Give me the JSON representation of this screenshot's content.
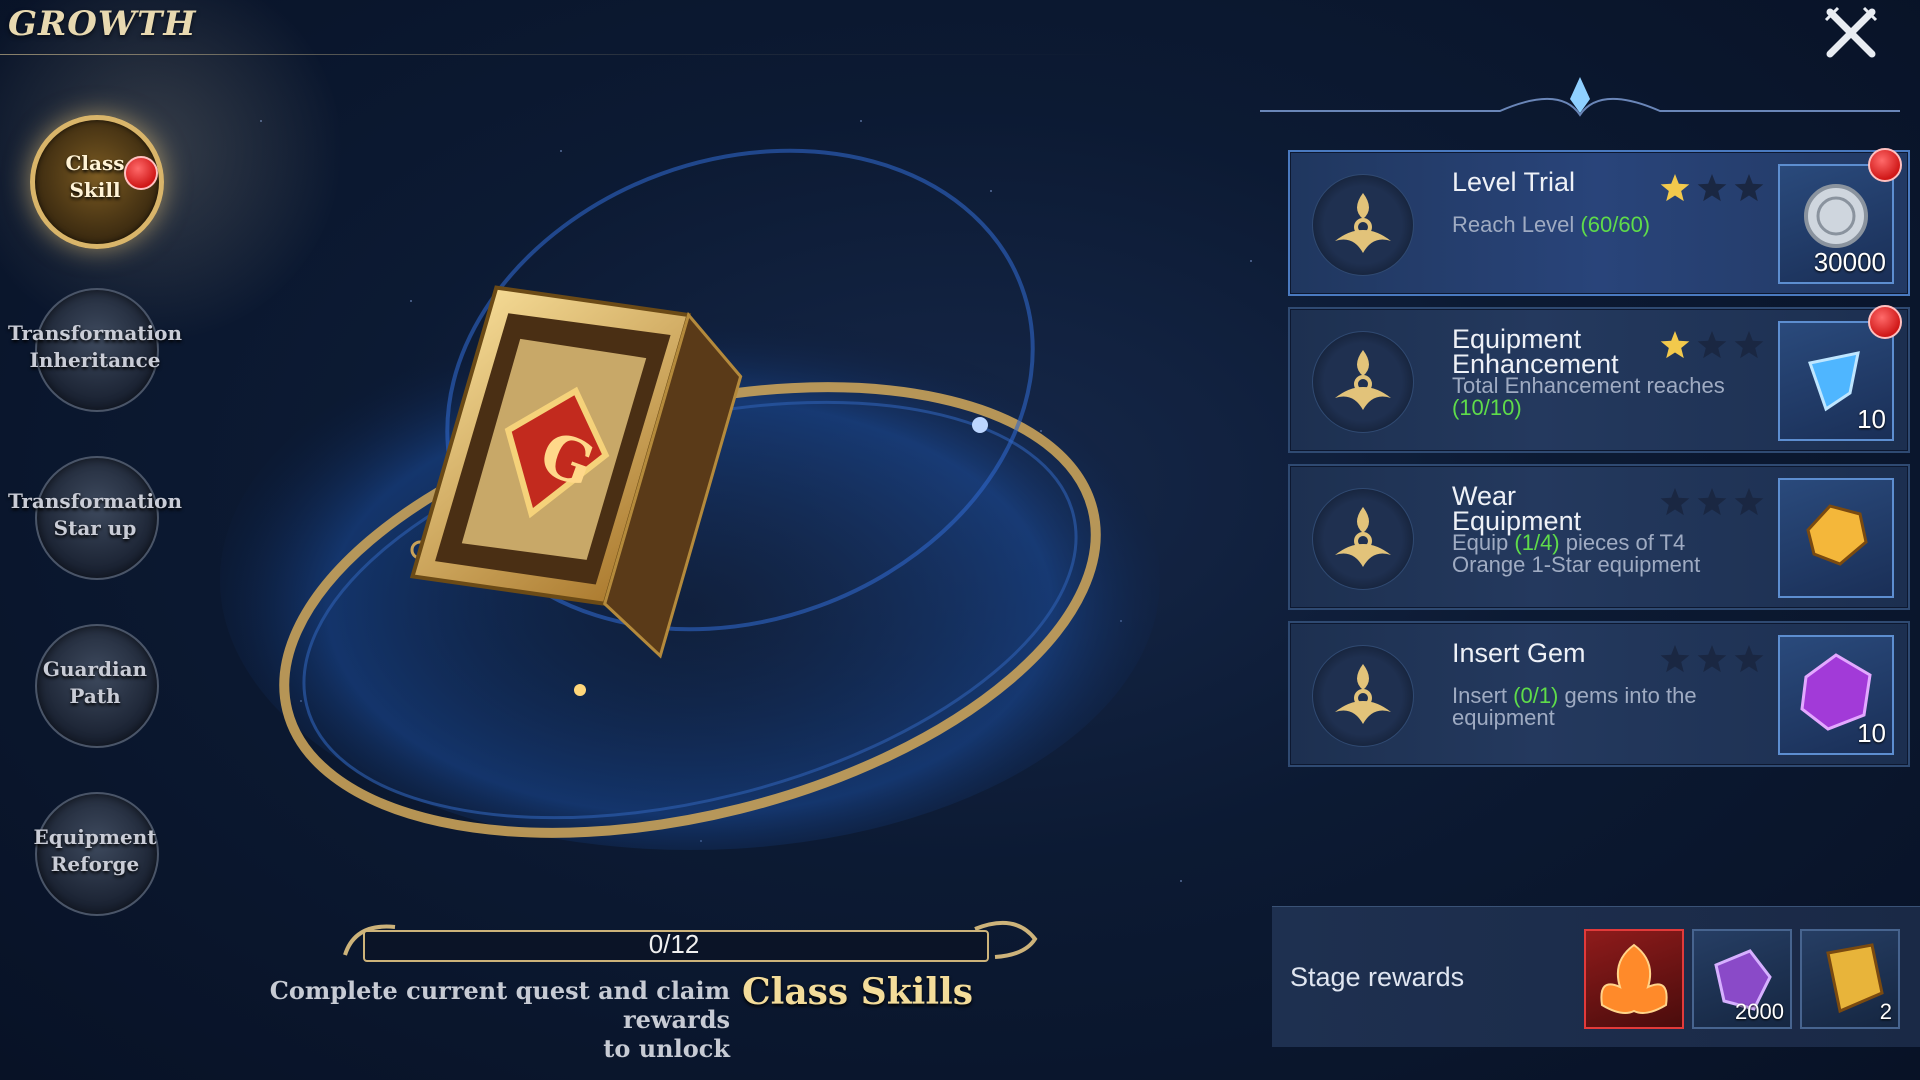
{
  "header": {
    "title": "GROWTH"
  },
  "nav": {
    "items": [
      {
        "label": "Class\nSkill",
        "active": true,
        "badge": true
      },
      {
        "label": "Transformation\nInheritance",
        "active": false,
        "badge": false
      },
      {
        "label": "Transformation\nStar up",
        "active": false,
        "badge": false
      },
      {
        "label": "Guardian\nPath",
        "active": false,
        "badge": false
      },
      {
        "label": "Equipment\nReforge",
        "active": false,
        "badge": false
      }
    ]
  },
  "progress": {
    "text": "0/12",
    "value": 0,
    "max": 12,
    "unlock_text": "Complete current quest and claim rewards\nto unlock",
    "unlock_target": "Class Skills"
  },
  "quests": [
    {
      "title": "Level Trial",
      "desc_parts": [
        "Reach Level ",
        "(60/60)",
        ""
      ],
      "stars_earned": 1,
      "stars_total": 3,
      "reward_icon": "silver-coin-icon",
      "reward_count": "30000",
      "badge": true,
      "highlight": true
    },
    {
      "title": "Equipment\nEnhancement",
      "desc_parts": [
        "Total Enhancement reaches\n",
        "(10/10)",
        ""
      ],
      "stars_earned": 1,
      "stars_total": 3,
      "reward_icon": "blue-crystal-icon",
      "reward_count": "10",
      "badge": true,
      "highlight": false
    },
    {
      "title": "Wear\nEquipment",
      "desc_parts": [
        "Equip ",
        "(1/4)",
        " pieces of T4\nOrange 1-Star equipment"
      ],
      "stars_earned": 0,
      "stars_total": 3,
      "reward_icon": "gold-ore-icon",
      "reward_count": "",
      "badge": false,
      "highlight": false
    },
    {
      "title": "Insert Gem",
      "desc_parts": [
        "Insert ",
        "(0/1)",
        " gems into the\nequipment"
      ],
      "stars_earned": 0,
      "stars_total": 3,
      "reward_icon": "purple-gem-icon",
      "reward_count": "10",
      "badge": false,
      "highlight": false
    }
  ],
  "stage_rewards": {
    "label": "Stage rewards",
    "items": [
      {
        "icon": "phoenix-icon",
        "count": ""
      },
      {
        "icon": "purple-crystal-icon",
        "count": "2000"
      },
      {
        "icon": "gold-rune-icon",
        "count": "2"
      }
    ]
  },
  "colors": {
    "accent_gold": "#d9b56a",
    "progress_green": "#5fdc4a",
    "badge_red": "#d01818",
    "highlight_border": "#5d8ed0"
  }
}
